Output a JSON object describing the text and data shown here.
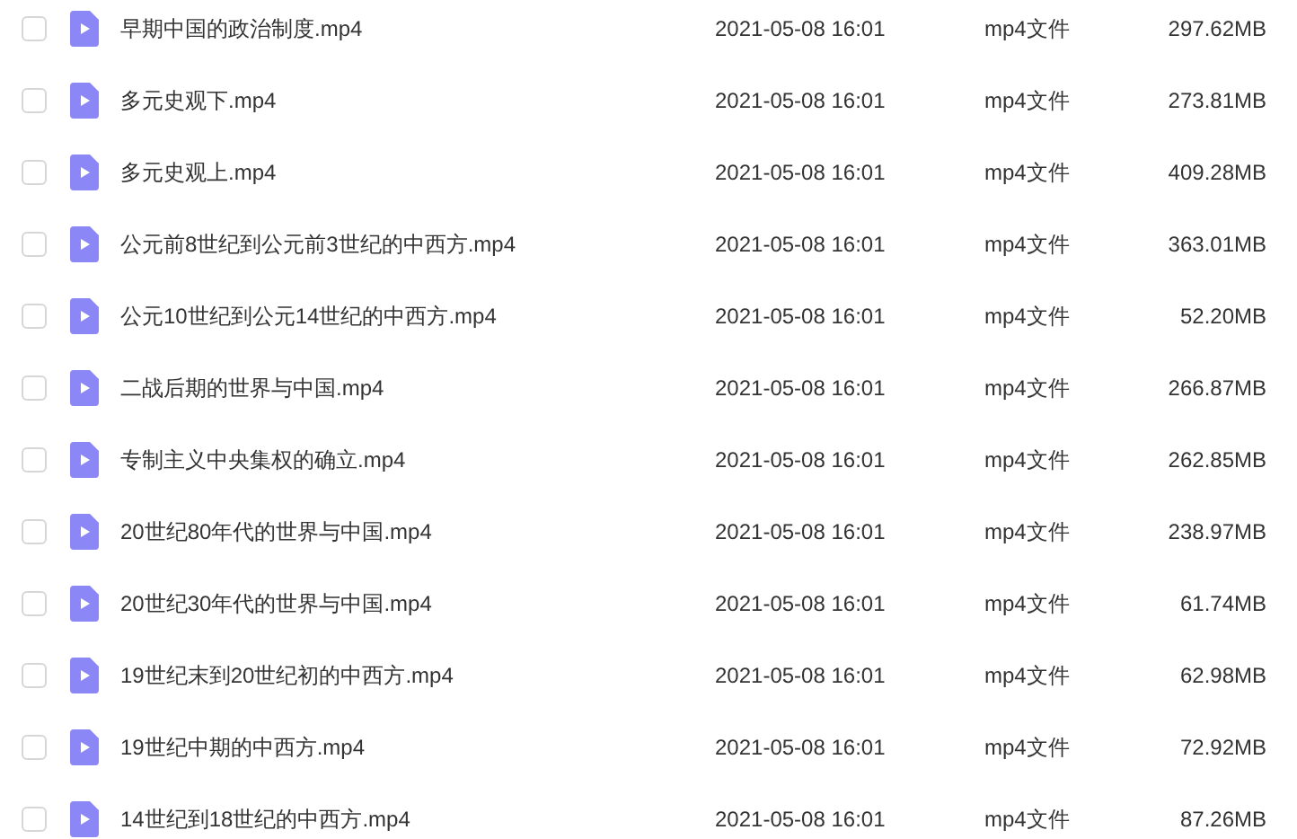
{
  "files": [
    {
      "name": "早期中国的政治制度.mp4",
      "modified": "2021-05-08 16:01",
      "type": "mp4文件",
      "size": "297.62MB",
      "checked": false
    },
    {
      "name": "多元史观下.mp4",
      "modified": "2021-05-08 16:01",
      "type": "mp4文件",
      "size": "273.81MB",
      "checked": false
    },
    {
      "name": "多元史观上.mp4",
      "modified": "2021-05-08 16:01",
      "type": "mp4文件",
      "size": "409.28MB",
      "checked": false
    },
    {
      "name": "公元前8世纪到公元前3世纪的中西方.mp4",
      "modified": "2021-05-08 16:01",
      "type": "mp4文件",
      "size": "363.01MB",
      "checked": false
    },
    {
      "name": "公元10世纪到公元14世纪的中西方.mp4",
      "modified": "2021-05-08 16:01",
      "type": "mp4文件",
      "size": "52.20MB",
      "checked": false
    },
    {
      "name": "二战后期的世界与中国.mp4",
      "modified": "2021-05-08 16:01",
      "type": "mp4文件",
      "size": "266.87MB",
      "checked": false
    },
    {
      "name": "专制主义中央集权的确立.mp4",
      "modified": "2021-05-08 16:01",
      "type": "mp4文件",
      "size": "262.85MB",
      "checked": false
    },
    {
      "name": "20世纪80年代的世界与中国.mp4",
      "modified": "2021-05-08 16:01",
      "type": "mp4文件",
      "size": "238.97MB",
      "checked": false
    },
    {
      "name": "20世纪30年代的世界与中国.mp4",
      "modified": "2021-05-08 16:01",
      "type": "mp4文件",
      "size": "61.74MB",
      "checked": false
    },
    {
      "name": "19世纪末到20世纪初的中西方.mp4",
      "modified": "2021-05-08 16:01",
      "type": "mp4文件",
      "size": "62.98MB",
      "checked": false
    },
    {
      "name": "19世纪中期的中西方.mp4",
      "modified": "2021-05-08 16:01",
      "type": "mp4文件",
      "size": "72.92MB",
      "checked": false
    },
    {
      "name": "14世纪到18世纪的中西方.mp4",
      "modified": "2021-05-08 16:01",
      "type": "mp4文件",
      "size": "87.26MB",
      "checked": false
    }
  ]
}
